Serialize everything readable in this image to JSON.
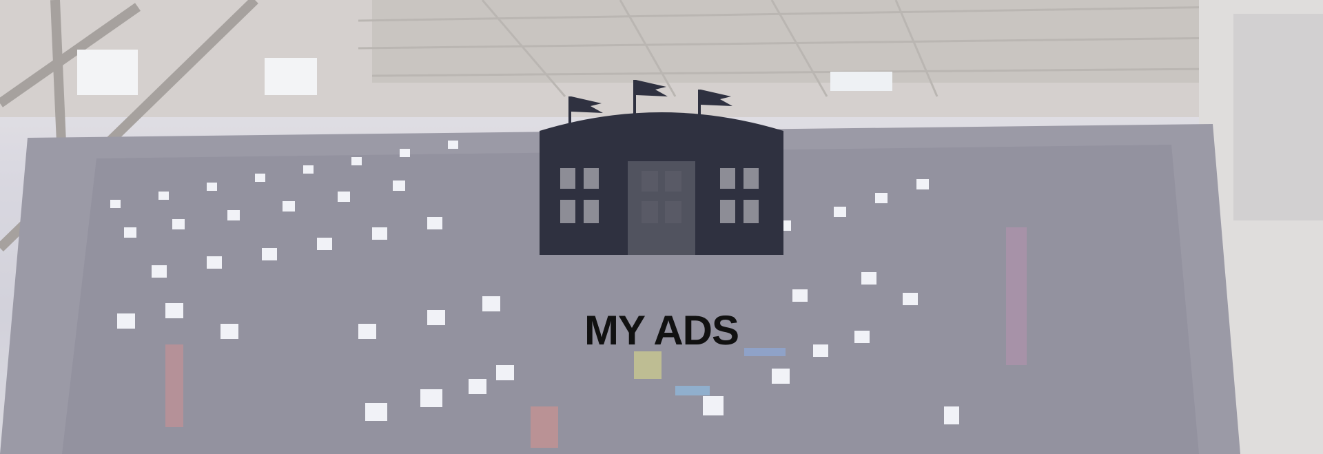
{
  "banner": {
    "title": "MY ADS",
    "title_color": "#111111",
    "logo_icon": "arena-building-icon",
    "logo_color": "#2f3140",
    "background_icon": "lan-party-hall-photo"
  }
}
